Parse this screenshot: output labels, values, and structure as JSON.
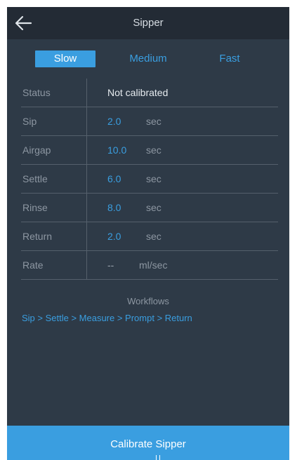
{
  "header": {
    "title": "Sipper",
    "back_icon": "arrow-left-icon"
  },
  "speed_tabs": [
    {
      "label": "Slow",
      "active": true
    },
    {
      "label": "Medium",
      "active": false
    },
    {
      "label": "Fast",
      "active": false
    }
  ],
  "settings": {
    "status": {
      "label": "Status",
      "value": "Not calibrated"
    },
    "sip": {
      "label": "Sip",
      "value": "2.0",
      "unit": "sec"
    },
    "airgap": {
      "label": "Airgap",
      "value": "10.0",
      "unit": "sec"
    },
    "settle": {
      "label": "Settle",
      "value": "6.0",
      "unit": "sec"
    },
    "rinse": {
      "label": "Rinse",
      "value": "8.0",
      "unit": "sec"
    },
    "return": {
      "label": "Return",
      "value": "2.0",
      "unit": "sec"
    },
    "rate": {
      "label": "Rate",
      "value": "--",
      "unit": "ml/sec"
    }
  },
  "workflows": {
    "title": "Workflows",
    "sequence": "Sip > Settle > Measure > Prompt > Return"
  },
  "actions": {
    "calibrate_label": "Calibrate Sipper"
  },
  "colors": {
    "accent": "#3a9ee0",
    "background": "#2e3a47",
    "header": "#232b35"
  }
}
